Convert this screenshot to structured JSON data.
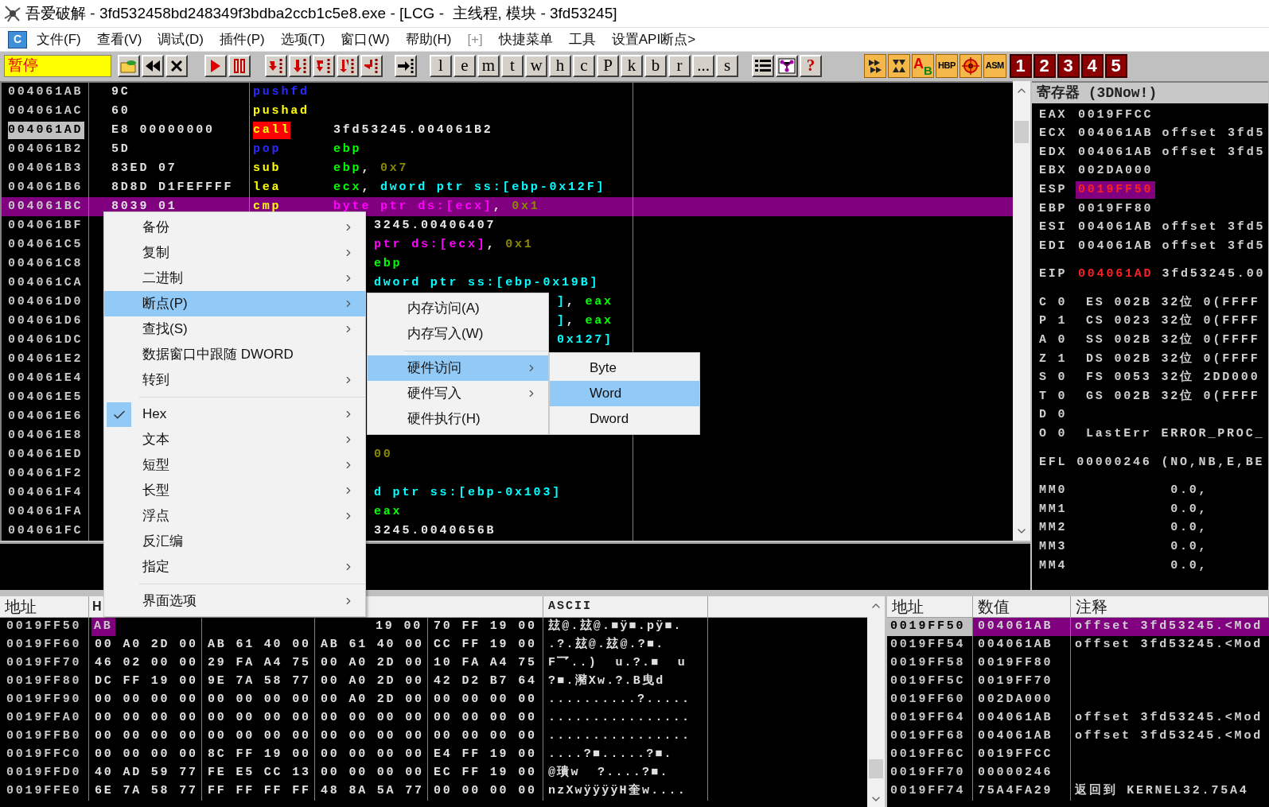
{
  "window": {
    "title": "吾爱破解 - 3fd532458bd248349f3bdba2ccb1c5e8.exe - [LCG -  主线程, 模块 - 3fd53245]"
  },
  "menu_bar": {
    "app_icon": "C",
    "items": [
      {
        "label": "文件(F)",
        "disabled": false
      },
      {
        "label": "查看(V)",
        "disabled": false
      },
      {
        "label": "调试(D)",
        "disabled": false
      },
      {
        "label": "插件(P)",
        "disabled": false
      },
      {
        "label": "选项(T)",
        "disabled": false
      },
      {
        "label": "窗口(W)",
        "disabled": false
      },
      {
        "label": "帮助(H)",
        "disabled": false
      },
      {
        "label": "[+]",
        "disabled": true
      },
      {
        "label": "快捷菜单",
        "disabled": false
      },
      {
        "label": "工具",
        "disabled": false
      },
      {
        "label": "设置API断点>",
        "disabled": false
      }
    ]
  },
  "toolbar": {
    "status": "暂停",
    "groups": [
      [
        {
          "kind": "open"
        },
        {
          "kind": "restart"
        },
        {
          "kind": "close"
        }
      ],
      [
        {
          "kind": "run"
        },
        {
          "kind": "pause"
        }
      ],
      [
        {
          "kind": "step-into"
        },
        {
          "kind": "step-over"
        },
        {
          "kind": "trace-into"
        },
        {
          "kind": "trace-over"
        },
        {
          "kind": "return"
        }
      ],
      [
        {
          "kind": "goto"
        }
      ],
      [
        {
          "kind": "letter",
          "label": "l"
        },
        {
          "kind": "letter",
          "label": "e"
        },
        {
          "kind": "letter",
          "label": "m"
        },
        {
          "kind": "letter",
          "label": "t"
        },
        {
          "kind": "letter",
          "label": "w"
        },
        {
          "kind": "letter",
          "label": "h"
        },
        {
          "kind": "letter",
          "label": "c"
        },
        {
          "kind": "letter",
          "label": "P"
        },
        {
          "kind": "letter",
          "label": "k"
        },
        {
          "kind": "letter",
          "label": "b"
        },
        {
          "kind": "letter",
          "label": "r"
        },
        {
          "kind": "letter",
          "label": "..."
        },
        {
          "kind": "letter",
          "label": "s"
        }
      ],
      [
        {
          "kind": "list"
        },
        {
          "kind": "graph"
        },
        {
          "kind": "help",
          "label": "?"
        }
      ],
      [
        {
          "kind": "anim-into"
        },
        {
          "kind": "anim-over"
        },
        {
          "kind": "ab",
          "labels": [
            "A",
            "B"
          ]
        },
        {
          "kind": "tag",
          "label": "HBP"
        },
        {
          "kind": "target"
        },
        {
          "kind": "tag",
          "label": "ASM"
        }
      ],
      [
        {
          "kind": "number",
          "label": "1"
        },
        {
          "kind": "number",
          "label": "2"
        },
        {
          "kind": "number",
          "label": "3"
        },
        {
          "kind": "number",
          "label": "4"
        },
        {
          "kind": "number",
          "label": "5"
        }
      ]
    ]
  },
  "disassembly": {
    "rows": [
      {
        "kind": "full",
        "address": "004061AB",
        "hex": "9C",
        "mnemonic": {
          "kind": "stack",
          "text": "pushfd"
        },
        "current": false,
        "selected": false
      },
      {
        "kind": "full",
        "address": "004061AC",
        "hex": "60",
        "mnemonic": {
          "kind": "other",
          "text": "pushad"
        },
        "current": false,
        "selected": false
      },
      {
        "kind": "full",
        "address": "004061AD",
        "hex": "E8 00000000",
        "mnemonic": {
          "kind": "call",
          "text": "call"
        },
        "operand": [
          {
            "kind": "label",
            "text": "3fd53245.004061B2"
          }
        ],
        "current": true,
        "selected": false
      },
      {
        "kind": "full",
        "address": "004061B2",
        "hex": "5D",
        "mnemonic": {
          "kind": "stack",
          "text": "pop"
        },
        "operand": [
          {
            "kind": "reg",
            "text": "ebp"
          }
        ],
        "current": false,
        "selected": false
      },
      {
        "kind": "full",
        "address": "004061B3",
        "hex": "83ED 07",
        "mnemonic": {
          "kind": "other",
          "text": "sub"
        },
        "operand": [
          {
            "kind": "reg",
            "text": "ebp"
          },
          {
            "kind": "punct",
            "text": ", "
          },
          {
            "kind": "imm",
            "text": "0x7"
          }
        ],
        "current": false,
        "selected": false
      },
      {
        "kind": "full",
        "address": "004061B6",
        "hex": "8D8D D1FEFFFF",
        "mnemonic": {
          "kind": "other",
          "text": "lea"
        },
        "operand": [
          {
            "kind": "reg",
            "text": "ecx"
          },
          {
            "kind": "punct",
            "text": ", "
          },
          {
            "kind": "mem",
            "text": "dword ptr ss:[ebp-0x12F]"
          }
        ],
        "current": false,
        "selected": false
      },
      {
        "kind": "full",
        "address": "004061BC",
        "hex": "8039 01",
        "mnemonic": {
          "kind": "other",
          "text": "cmp"
        },
        "operand": [
          {
            "kind": "mem8",
            "text": "byte ptr ds:[ecx]"
          },
          {
            "kind": "punct",
            "text": ", "
          },
          {
            "kind": "imm",
            "text": "0x1"
          }
        ],
        "current": false,
        "selected": true
      },
      {
        "kind": "cut",
        "address": "004061BF",
        "operand": [
          {
            "kind": "label",
            "text": "3245.00406407"
          }
        ],
        "current": false,
        "selected": false
      },
      {
        "kind": "cut",
        "address": "004061C5",
        "operand": [
          {
            "kind": "mem8",
            "text": "ptr ds:[ecx]"
          },
          {
            "kind": "punct",
            "text": ", "
          },
          {
            "kind": "imm",
            "text": "0x1"
          }
        ],
        "current": false,
        "selected": false
      },
      {
        "kind": "cut",
        "address": "004061C8",
        "operand": [
          {
            "kind": "reg",
            "text": "ebp"
          }
        ],
        "current": false,
        "selected": false
      },
      {
        "kind": "cut",
        "address": "004061CA",
        "operand": [
          {
            "kind": "mem",
            "text": "dword ptr ss:[ebp-0x19B]"
          }
        ],
        "current": false,
        "selected": false
      },
      {
        "kind": "far",
        "address": "004061D0",
        "operand": [
          {
            "kind": "mem",
            "text": "]"
          },
          {
            "kind": "punct",
            "text": ", "
          },
          {
            "kind": "reg",
            "text": "eax"
          }
        ],
        "current": false,
        "selected": false
      },
      {
        "kind": "far",
        "address": "004061D6",
        "operand": [
          {
            "kind": "mem",
            "text": "]"
          },
          {
            "kind": "punct",
            "text": ", "
          },
          {
            "kind": "reg",
            "text": "eax"
          }
        ],
        "current": false,
        "selected": false
      },
      {
        "kind": "far",
        "address": "004061DC",
        "operand": [
          {
            "kind": "mem",
            "text": "0x127]"
          }
        ],
        "current": false,
        "selected": false
      },
      {
        "kind": "cut",
        "address": "004061E2",
        "current": false,
        "selected": false
      },
      {
        "kind": "cut",
        "address": "004061E4",
        "current": false,
        "selected": false
      },
      {
        "kind": "cut",
        "address": "004061E5",
        "current": false,
        "selected": false
      },
      {
        "kind": "cut",
        "address": "004061E6",
        "current": false,
        "selected": false
      },
      {
        "kind": "cut",
        "address": "004061E8",
        "current": false,
        "selected": false
      },
      {
        "kind": "cut",
        "address": "004061ED",
        "operand": [
          {
            "kind": "imm",
            "text": "00"
          }
        ],
        "current": false,
        "selected": false
      },
      {
        "kind": "cut",
        "address": "004061F2",
        "current": false,
        "selected": false
      },
      {
        "kind": "cut",
        "address": "004061F4",
        "operand": [
          {
            "kind": "mem",
            "text": "d ptr ss:[ebp-0x103]"
          }
        ],
        "current": false,
        "selected": false
      },
      {
        "kind": "cut",
        "address": "004061FA",
        "operand": [
          {
            "kind": "reg",
            "text": "eax"
          }
        ],
        "current": false,
        "selected": false
      },
      {
        "kind": "cut",
        "address": "004061FC",
        "operand": [
          {
            "kind": "label",
            "text": "3245.0040656B"
          }
        ],
        "current": false,
        "selected": false
      }
    ]
  },
  "registers": {
    "title": "寄存器 (3DNow!)",
    "groups": [
      [
        {
          "kind": "reg",
          "name": "EAX",
          "value": "0019FFCC",
          "changed": false,
          "selected": false
        },
        {
          "kind": "reg",
          "name": "ECX",
          "value": "004061AB",
          "comment": "offset 3fd5",
          "changed": false,
          "selected": false
        },
        {
          "kind": "reg",
          "name": "EDX",
          "value": "004061AB",
          "comment": "offset 3fd5",
          "changed": false,
          "selected": false
        },
        {
          "kind": "reg",
          "name": "EBX",
          "value": "002DA000",
          "changed": false,
          "selected": false
        },
        {
          "kind": "reg",
          "name": "ESP",
          "value": "0019FF50",
          "changed": true,
          "selected": true
        },
        {
          "kind": "reg",
          "name": "EBP",
          "value": "0019FF80",
          "changed": false,
          "selected": false
        },
        {
          "kind": "reg",
          "name": "ESI",
          "value": "004061AB",
          "comment": "offset 3fd5",
          "changed": false,
          "selected": false
        },
        {
          "kind": "reg",
          "name": "EDI",
          "value": "004061AB",
          "comment": "offset 3fd5",
          "changed": false,
          "selected": false
        }
      ],
      [
        {
          "kind": "reg",
          "name": "EIP",
          "value": "004061AD",
          "comment": "3fd53245.00",
          "changed": true,
          "selected": false
        }
      ],
      [
        {
          "kind": "text",
          "text": "C 0  ES 002B 32位 0(FFFF"
        },
        {
          "kind": "text",
          "text": "P 1  CS 0023 32位 0(FFFF"
        },
        {
          "kind": "text",
          "text": "A 0  SS 002B 32位 0(FFFF"
        },
        {
          "kind": "text",
          "text": "Z 1  DS 002B 32位 0(FFFF"
        },
        {
          "kind": "text",
          "text": "S 0  FS 0053 32位 2DD000"
        },
        {
          "kind": "text",
          "text": "T 0  GS 002B 32位 0(FFFF"
        },
        {
          "kind": "text",
          "text": "D 0"
        },
        {
          "kind": "text",
          "text": "O 0  LastErr ERROR_PROC_"
        }
      ],
      [
        {
          "kind": "text",
          "text": "EFL 00000246 (NO,NB,E,BE"
        }
      ],
      [
        {
          "kind": "text",
          "text": "MM0           0.0,"
        },
        {
          "kind": "text",
          "text": "MM1           0.0,"
        },
        {
          "kind": "text",
          "text": "MM2           0.0,"
        },
        {
          "kind": "text",
          "text": "MM3           0.0,"
        },
        {
          "kind": "text",
          "text": "MM4           0.0,"
        }
      ]
    ]
  },
  "dump": {
    "columns": [
      "地址",
      "H",
      "ASCII"
    ],
    "rows": [
      {
        "kind": "cut",
        "address": "0019FF50",
        "head": "AB",
        "tail": "19 00",
        "groups": [
          "70 FF 19 00"
        ],
        "ascii": "玆@.玆@.■ÿ■.pÿ■."
      },
      {
        "kind": "full",
        "address": "0019FF60",
        "groups": [
          "00 A0 2D 00",
          "AB 61 40 00",
          "AB 61 40 00",
          "CC FF 19 00"
        ],
        "ascii": ".?.玆@.玆@.?■."
      },
      {
        "kind": "full",
        "address": "0019FF70",
        "groups": [
          "46 02 00 00",
          "29 FA A4 75",
          "00 A0 2D 00",
          "10 FA A4 75"
        ],
        "ascii": "F乛..)  u.?.■  u"
      },
      {
        "kind": "full",
        "address": "0019FF80",
        "groups": [
          "DC FF 19 00",
          "9E 7A 58 77",
          "00 A0 2D 00",
          "42 D2 B7 64"
        ],
        "ascii": "?■.瀦Xw.?.B曳d"
      },
      {
        "kind": "full",
        "address": "0019FF90",
        "groups": [
          "00 00 00 00",
          "00 00 00 00",
          "00 A0 2D 00",
          "00 00 00 00"
        ],
        "ascii": "..........?....."
      },
      {
        "kind": "full",
        "address": "0019FFA0",
        "groups": [
          "00 00 00 00",
          "00 00 00 00",
          "00 00 00 00",
          "00 00 00 00"
        ],
        "ascii": "................"
      },
      {
        "kind": "full",
        "address": "0019FFB0",
        "groups": [
          "00 00 00 00",
          "00 00 00 00",
          "00 00 00 00",
          "00 00 00 00"
        ],
        "ascii": "................"
      },
      {
        "kind": "full",
        "address": "0019FFC0",
        "groups": [
          "00 00 00 00",
          "8C FF 19 00",
          "00 00 00 00",
          "E4 FF 19 00"
        ],
        "ascii": "....?■.....?■."
      },
      {
        "kind": "full",
        "address": "0019FFD0",
        "groups": [
          "40 AD 59 77",
          "FE E5 CC 13",
          "00 00 00 00",
          "EC FF 19 00"
        ],
        "ascii": "@璝w  ?....?■."
      },
      {
        "kind": "full",
        "address": "0019FFE0",
        "groups": [
          "6E 7A 58 77",
          "FF FF FF FF",
          "48 8A 5A 77",
          "00 00 00 00"
        ],
        "ascii": "nzXwÿÿÿÿH奎w...."
      }
    ]
  },
  "stack": {
    "columns": [
      "地址",
      "数值",
      "注释"
    ],
    "rows": [
      {
        "address": "0019FF50",
        "value": "004061AB",
        "comment": "offset 3fd53245.<Mod",
        "selected": true
      },
      {
        "address": "0019FF54",
        "value": "004061AB",
        "comment": "offset 3fd53245.<Mod",
        "selected": false
      },
      {
        "address": "0019FF58",
        "value": "0019FF80",
        "selected": false
      },
      {
        "address": "0019FF5C",
        "value": "0019FF70",
        "selected": false
      },
      {
        "address": "0019FF60",
        "value": "002DA000",
        "selected": false
      },
      {
        "address": "0019FF64",
        "value": "004061AB",
        "comment": "offset 3fd53245.<Mod",
        "selected": false
      },
      {
        "address": "0019FF68",
        "value": "004061AB",
        "comment": "offset 3fd53245.<Mod",
        "selected": false
      },
      {
        "address": "0019FF6C",
        "value": "0019FFCC",
        "selected": false
      },
      {
        "address": "0019FF70",
        "value": "00000246",
        "selected": false
      },
      {
        "address": "0019FF74",
        "value": "75A4FA29",
        "comment": "返回到 KERNEL32.75A4",
        "selected": false
      }
    ]
  },
  "context_menu": {
    "items": [
      {
        "kind": "item",
        "label": "备份",
        "submenu": true,
        "checked": false,
        "selected": false
      },
      {
        "kind": "item",
        "label": "复制",
        "submenu": true,
        "checked": false,
        "selected": false
      },
      {
        "kind": "item",
        "label": "二进制",
        "submenu": true,
        "checked": false,
        "selected": false
      },
      {
        "kind": "item",
        "label": "断点(P)",
        "submenu": true,
        "checked": false,
        "selected": true
      },
      {
        "kind": "item",
        "label": "查找(S)",
        "submenu": true,
        "checked": false,
        "selected": false
      },
      {
        "kind": "item",
        "label": "数据窗口中跟随 DWORD",
        "submenu": false,
        "checked": false,
        "selected": false
      },
      {
        "kind": "item",
        "label": "转到",
        "submenu": true,
        "checked": false,
        "selected": false
      },
      {
        "kind": "separator"
      },
      {
        "kind": "item",
        "label": "Hex",
        "submenu": true,
        "checked": true,
        "selected": false
      },
      {
        "kind": "item",
        "label": "文本",
        "submenu": true,
        "checked": false,
        "selected": false
      },
      {
        "kind": "item",
        "label": "短型",
        "submenu": true,
        "checked": false,
        "selected": false
      },
      {
        "kind": "item",
        "label": "长型",
        "submenu": true,
        "checked": false,
        "selected": false
      },
      {
        "kind": "item",
        "label": "浮点",
        "submenu": true,
        "checked": false,
        "selected": false
      },
      {
        "kind": "item",
        "label": "反汇编",
        "submenu": false,
        "checked": false,
        "selected": false
      },
      {
        "kind": "item",
        "label": "指定",
        "submenu": true,
        "checked": false,
        "selected": false
      },
      {
        "kind": "separator"
      },
      {
        "kind": "item",
        "label": "界面选项",
        "submenu": true,
        "checked": false,
        "selected": false
      }
    ]
  },
  "breakpoint_menu": {
    "items": [
      {
        "kind": "item",
        "label": "内存访问(A)",
        "submenu": false,
        "checked": false,
        "selected": false
      },
      {
        "kind": "item",
        "label": "内存写入(W)",
        "submenu": false,
        "checked": false,
        "selected": false
      },
      {
        "kind": "separator"
      },
      {
        "kind": "item",
        "label": "硬件访问",
        "submenu": true,
        "checked": false,
        "selected": true
      },
      {
        "kind": "item",
        "label": "硬件写入",
        "submenu": true,
        "checked": false,
        "selected": false
      },
      {
        "kind": "item",
        "label": "硬件执行(H)",
        "submenu": false,
        "checked": false,
        "selected": false
      }
    ]
  },
  "hardware_menu": {
    "items": [
      {
        "kind": "item",
        "label": "Byte",
        "submenu": false,
        "checked": false,
        "selected": false
      },
      {
        "kind": "item",
        "label": "Word",
        "submenu": false,
        "checked": false,
        "selected": true
      },
      {
        "kind": "item",
        "label": "Dword",
        "submenu": false,
        "checked": false,
        "selected": false
      }
    ]
  }
}
